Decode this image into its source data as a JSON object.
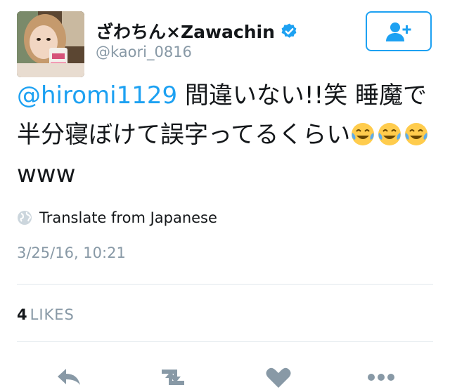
{
  "user": {
    "display_name": "ざわちん×Zawachin",
    "username": "@kaori_0816",
    "verified": true,
    "avatar": "avatar-photo"
  },
  "follow_button": {
    "icon": "add-user-icon"
  },
  "tweet": {
    "mention": "@hiromi1129",
    "text_after_mention": " 間違いない!!笑 睡魔で半分寝ぼけて誤字ってるくらい",
    "emojis": [
      "face-with-tears-of-joy",
      "face-with-tears-of-joy",
      "face-with-tears-of-joy"
    ],
    "trailing": "www"
  },
  "translate": {
    "label": "Translate from Japanese",
    "icon": "globe-icon"
  },
  "timestamp": "3/25/16, 10:21",
  "likes": {
    "count": "4",
    "label": "LIKES"
  },
  "actions": [
    "reply-icon",
    "retweet-icon",
    "like-icon",
    "more-icon"
  ],
  "colors": {
    "accent": "#1da1f2",
    "text": "#14171a",
    "muted": "#8899a6",
    "divider": "#e1e8ed",
    "action_icon": "#8899a6"
  }
}
